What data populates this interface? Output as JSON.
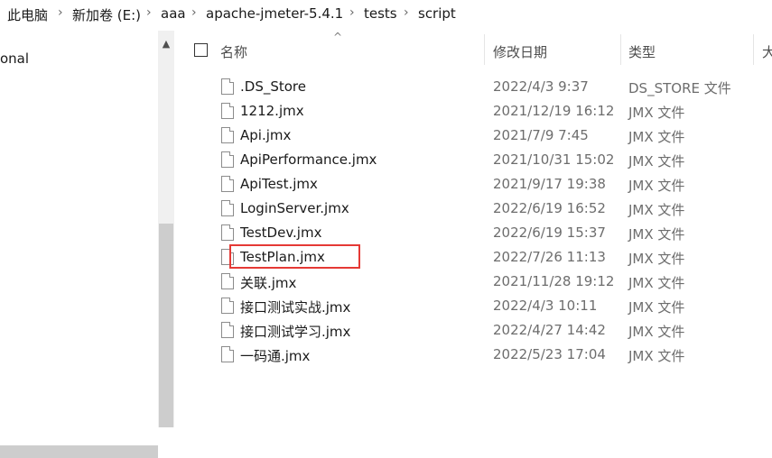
{
  "breadcrumb": [
    "此电脑",
    "新加卷 (E:)",
    "aaa",
    "apache-jmeter-5.4.1",
    "tests",
    "script"
  ],
  "nav": {
    "partial_item": "onal"
  },
  "columns": {
    "name": "名称",
    "date": "修改日期",
    "type": "类型",
    "size": "大"
  },
  "files": [
    {
      "name": ".DS_Store",
      "date": "2022/4/3 9:37",
      "type": "DS_STORE 文件"
    },
    {
      "name": "1212.jmx",
      "date": "2021/12/19 16:12",
      "type": "JMX 文件"
    },
    {
      "name": "Api.jmx",
      "date": "2021/7/9 7:45",
      "type": "JMX 文件"
    },
    {
      "name": "ApiPerformance.jmx",
      "date": "2021/10/31 15:02",
      "type": "JMX 文件"
    },
    {
      "name": "ApiTest.jmx",
      "date": "2021/9/17 19:38",
      "type": "JMX 文件"
    },
    {
      "name": "LoginServer.jmx",
      "date": "2022/6/19 16:52",
      "type": "JMX 文件"
    },
    {
      "name": "TestDev.jmx",
      "date": "2022/6/19 15:37",
      "type": "JMX 文件"
    },
    {
      "name": "TestPlan.jmx",
      "date": "2022/7/26 11:13",
      "type": "JMX 文件"
    },
    {
      "name": "关联.jmx",
      "date": "2021/11/28 19:12",
      "type": "JMX 文件"
    },
    {
      "name": "接口测试实战.jmx",
      "date": "2022/4/3 10:11",
      "type": "JMX 文件"
    },
    {
      "name": "接口测试学习.jmx",
      "date": "2022/4/27 14:42",
      "type": "JMX 文件"
    },
    {
      "name": "一码通.jmx",
      "date": "2022/5/23 17:04",
      "type": "JMX 文件"
    }
  ],
  "highlight_color": "#e53935"
}
